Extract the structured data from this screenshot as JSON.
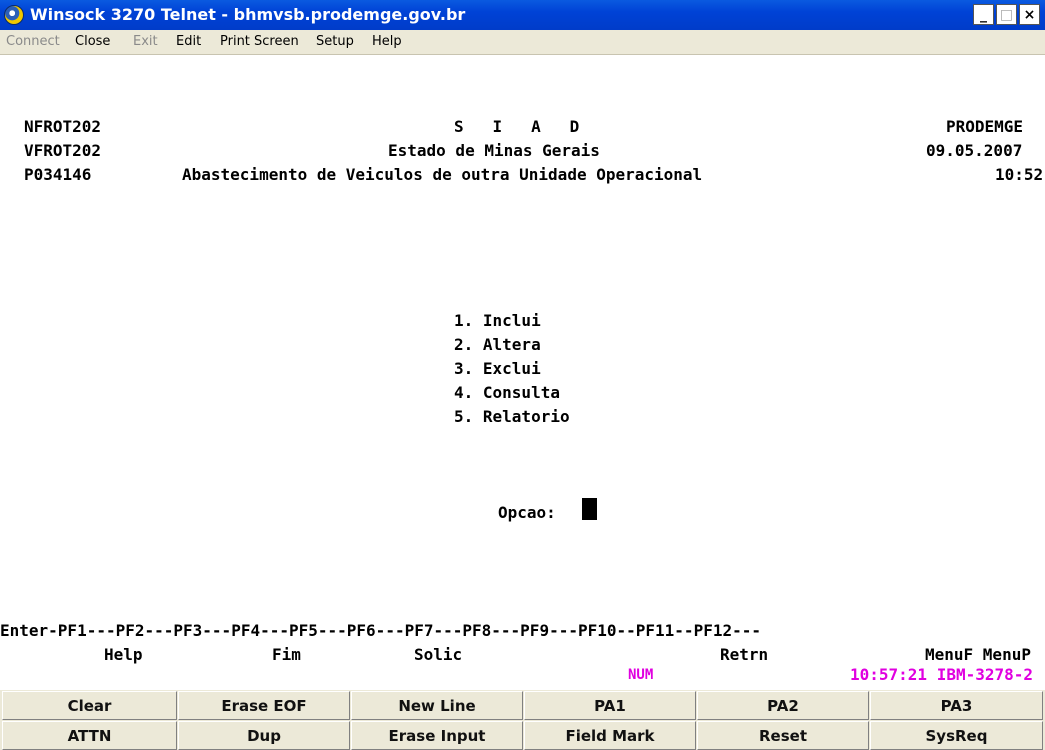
{
  "window": {
    "title": "Winsock 3270 Telnet - bhmvsb.prodemge.gov.br",
    "controls": {
      "minimize": "_",
      "maximize": "□",
      "close": "×"
    },
    "icon": "app-globe-icon"
  },
  "menu": {
    "items": [
      {
        "label": "Connect",
        "enabled": false
      },
      {
        "label": "Close",
        "enabled": true
      },
      {
        "label": "Exit",
        "enabled": false
      },
      {
        "label": "Edit",
        "enabled": true
      },
      {
        "label": "Print Screen",
        "enabled": true
      },
      {
        "label": "Setup",
        "enabled": true
      },
      {
        "label": "Help",
        "enabled": true
      }
    ]
  },
  "screen": {
    "header": {
      "program1": "NFROT202",
      "program2": "VFROT202",
      "program3": "P034146",
      "system": "S   I   A   D",
      "state": "Estado de Minas Gerais",
      "title": "Abastecimento de Veiculos de outra Unidade Operacional",
      "company": "PRODEMGE",
      "date": "09.05.2007",
      "time": "10:52"
    },
    "options": [
      "1. Inclui",
      "2. Altera",
      "3. Exclui",
      "4. Consulta",
      "5. Relatorio"
    ],
    "prompt": "Opcao:",
    "function_keys": "Enter-PF1---PF2---PF3---PF4---PF5---PF6---PF7---PF8---PF9---PF10--PF11--PF12---",
    "function_labels": {
      "help": "Help",
      "fim": "Fim",
      "solic": "Solic",
      "retrn": "Retrn",
      "menu": "MenuF MenuP"
    },
    "status": {
      "num": "NUM",
      "clock": "10:57:21 IBM-3278-2",
      "color": "#e000e0"
    }
  },
  "keypad": {
    "row1": [
      "Clear",
      "Erase EOF",
      "New Line",
      "PA1",
      "PA2",
      "PA3"
    ],
    "row2": [
      "ATTN",
      "Dup",
      "Erase Input",
      "Field Mark",
      "Reset",
      "SysReq"
    ]
  }
}
